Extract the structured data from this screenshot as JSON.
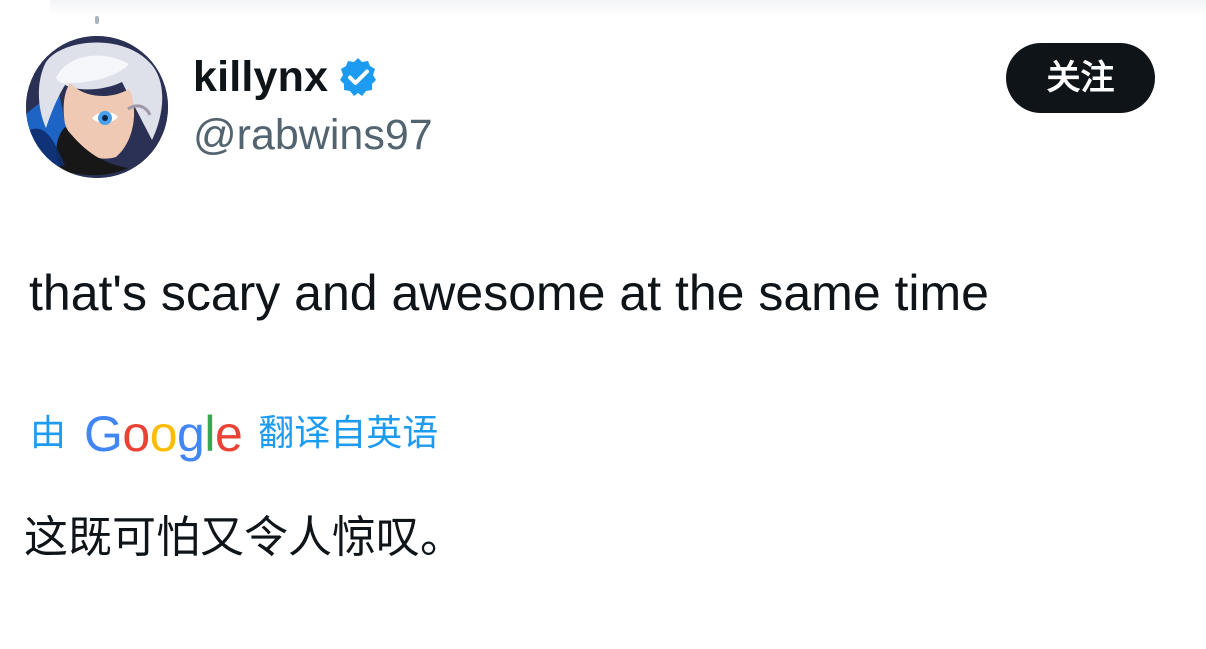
{
  "author": {
    "display_name": "killynx",
    "handle": "@rabwins97",
    "verified_icon": "verified-badge-icon",
    "avatar_description_icon": "anime-avatar"
  },
  "actions": {
    "follow_label": "关注"
  },
  "tweet": {
    "text": "that's scary and awesome at the same time"
  },
  "translation": {
    "prefix": "由",
    "provider": "Google",
    "suffix": "翻译自英语",
    "translated_text": "这既可怕又令人惊叹。"
  },
  "colors": {
    "link_blue": "#1d9bf0",
    "follow_button": "#0f1419",
    "handle_gray": "#536471"
  }
}
